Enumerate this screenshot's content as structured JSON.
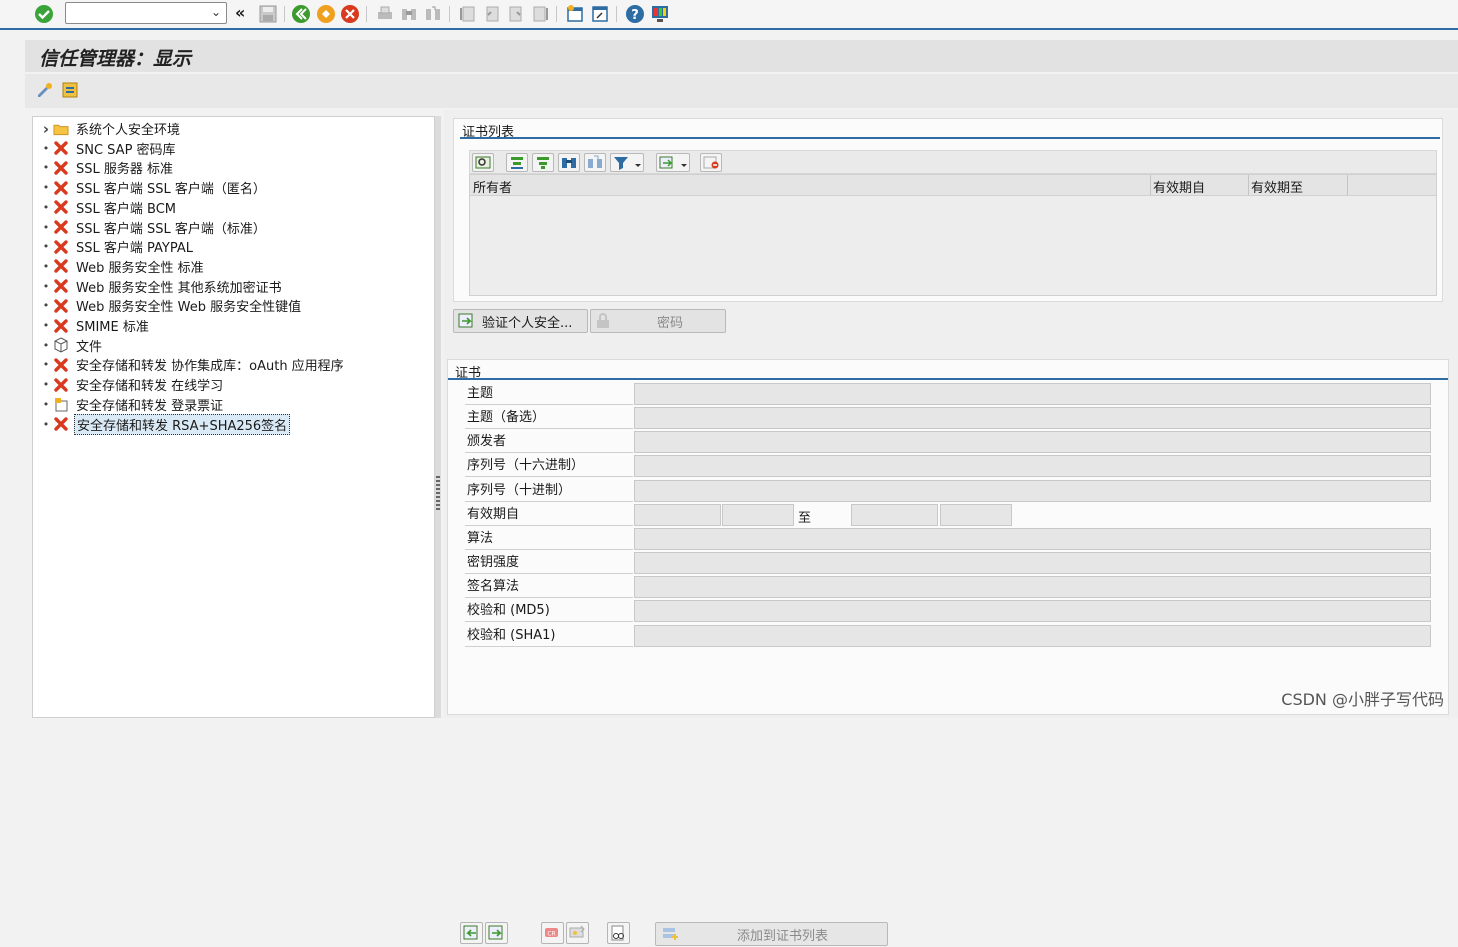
{
  "window": {
    "title": "信任管理器：显示"
  },
  "toolbar": {
    "command_field_value": ""
  },
  "tree": {
    "items": [
      {
        "label": "系统个人安全环境",
        "icon": "folder-icon",
        "bullet": "›"
      },
      {
        "label": "SNC SAP 密码库",
        "icon": "error-x-icon",
        "bullet": "•"
      },
      {
        "label": "SSL 服务器 标准",
        "icon": "error-x-icon",
        "bullet": "•"
      },
      {
        "label": "SSL 客户端 SSL 客户端（匿名）",
        "icon": "error-x-icon",
        "bullet": "•"
      },
      {
        "label": "SSL 客户端 BCM",
        "icon": "error-x-icon",
        "bullet": "•"
      },
      {
        "label": "SSL 客户端 SSL 客户端（标准）",
        "icon": "error-x-icon",
        "bullet": "•"
      },
      {
        "label": "SSL 客户端 PAYPAL",
        "icon": "error-x-icon",
        "bullet": "•"
      },
      {
        "label": "Web 服务安全性 标准",
        "icon": "error-x-icon",
        "bullet": "•"
      },
      {
        "label": "Web 服务安全性 其他系统加密证书",
        "icon": "error-x-icon",
        "bullet": "•"
      },
      {
        "label": "Web 服务安全性 Web 服务安全性键值",
        "icon": "error-x-icon",
        "bullet": "•"
      },
      {
        "label": "SMIME 标准",
        "icon": "error-x-icon",
        "bullet": "•"
      },
      {
        "label": "文件",
        "icon": "cube-icon",
        "bullet": "•"
      },
      {
        "label": "安全存储和转发 协作集成库：oAuth 应用程序",
        "icon": "error-x-icon",
        "bullet": "•"
      },
      {
        "label": "安全存储和转发 在线学习",
        "icon": "error-x-icon",
        "bullet": "•"
      },
      {
        "label": "安全存储和转发 登录票证",
        "icon": "ticket-icon",
        "bullet": "•"
      },
      {
        "label": "安全存储和转发 RSA+SHA256签名",
        "icon": "error-x-icon",
        "bullet": "•",
        "selected": true
      }
    ]
  },
  "cert_list": {
    "title": "证书列表",
    "columns": [
      "所有者",
      "有效期自",
      "有效期至"
    ],
    "rows": []
  },
  "buttons": {
    "verify_pse": "验证个人安全...",
    "password": "密码",
    "add_to_cert_list": "添加到证书列表"
  },
  "certificate": {
    "title": "证书",
    "fields": [
      {
        "label": "主题",
        "value": ""
      },
      {
        "label": "主题（备选）",
        "value": ""
      },
      {
        "label": "颁发者",
        "value": ""
      },
      {
        "label": "序列号（十六进制）",
        "value": ""
      },
      {
        "label": "序列号（十进制）",
        "value": ""
      },
      {
        "label": "有效期自",
        "value": ""
      },
      {
        "label": "算法",
        "value": ""
      },
      {
        "label": "密钥强度",
        "value": ""
      },
      {
        "label": "签名算法",
        "value": ""
      },
      {
        "label": "校验和 (MD5)",
        "value": ""
      },
      {
        "label": "校验和 (SHA1)",
        "value": ""
      }
    ],
    "validity_to_label": "至"
  },
  "watermark": "CSDN @小胖子写代码",
  "colors": {
    "accent": "#2d6da3",
    "error": "#d9391e",
    "ok": "#3aa33a"
  }
}
